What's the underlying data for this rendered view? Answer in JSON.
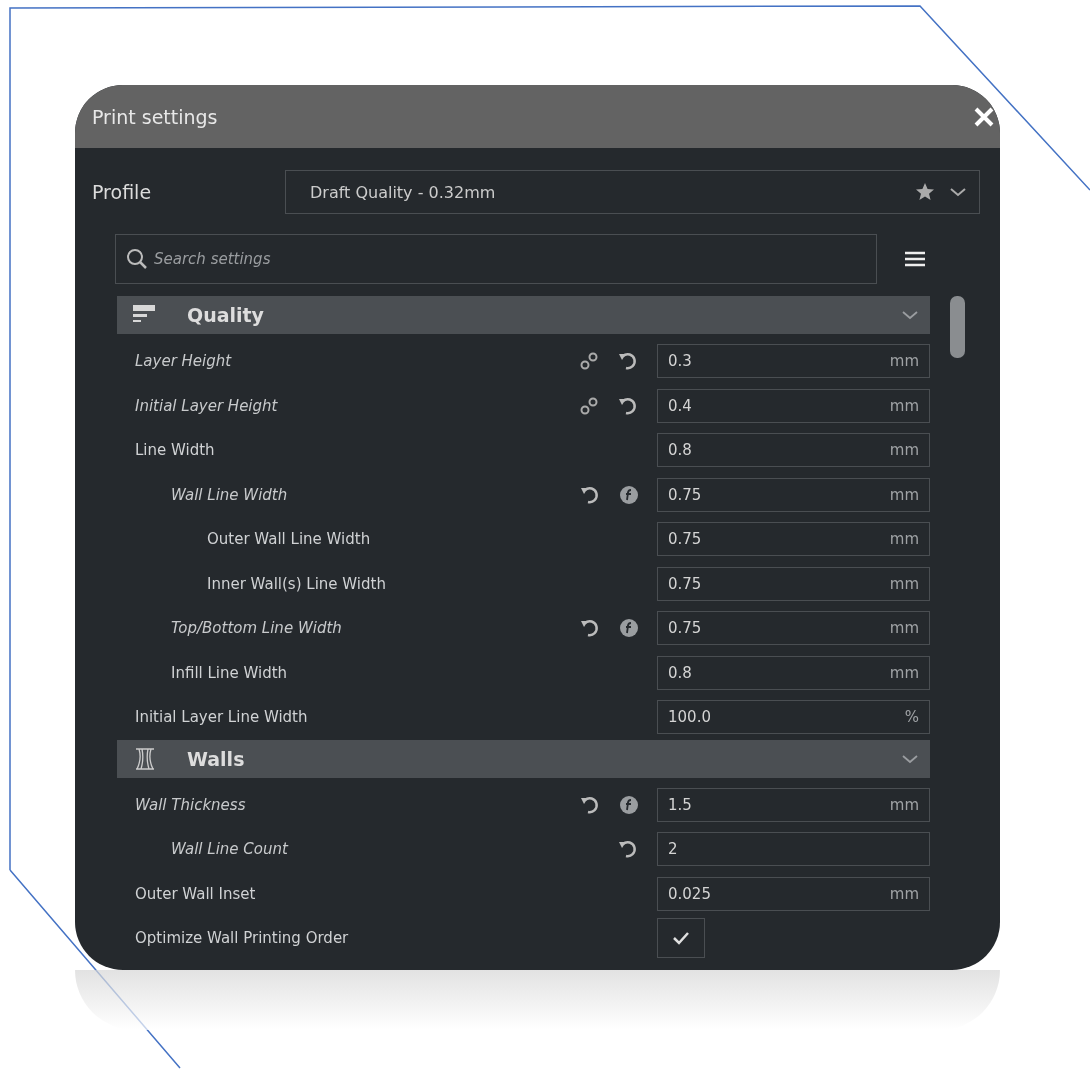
{
  "window": {
    "title": "Print settings"
  },
  "profile": {
    "label": "Profile",
    "value": "Draft Quality - 0.32mm"
  },
  "search": {
    "placeholder": "Search settings"
  },
  "sections": [
    {
      "title": "Quality",
      "kind": "quality",
      "expanded": true,
      "settings": [
        {
          "label": "Layer Height",
          "modified": true,
          "linked": true,
          "resettable": true,
          "formula": false,
          "kind": "number",
          "value": "0.3",
          "unit": "mm"
        },
        {
          "label": "Initial Layer Height",
          "modified": true,
          "linked": true,
          "resettable": true,
          "formula": false,
          "kind": "number",
          "value": "0.4",
          "unit": "mm"
        },
        {
          "label": "Line Width",
          "modified": false,
          "linked": false,
          "resettable": false,
          "formula": false,
          "kind": "number",
          "value": "0.8",
          "unit": "mm",
          "children": [
            {
              "label": "Wall Line Width",
              "modified": true,
              "linked": false,
              "resettable": true,
              "formula": true,
              "kind": "number",
              "value": "0.75",
              "unit": "mm",
              "children": [
                {
                  "label": "Outer Wall Line Width",
                  "modified": false,
                  "linked": false,
                  "resettable": false,
                  "formula": false,
                  "kind": "number",
                  "value": "0.75",
                  "unit": "mm"
                },
                {
                  "label": "Inner Wall(s) Line Width",
                  "modified": false,
                  "linked": false,
                  "resettable": false,
                  "formula": false,
                  "kind": "number",
                  "value": "0.75",
                  "unit": "mm"
                }
              ]
            },
            {
              "label": "Top/Bottom Line Width",
              "modified": true,
              "linked": false,
              "resettable": true,
              "formula": true,
              "kind": "number",
              "value": "0.75",
              "unit": "mm"
            },
            {
              "label": "Infill Line Width",
              "modified": false,
              "linked": false,
              "resettable": false,
              "formula": false,
              "kind": "number",
              "value": "0.8",
              "unit": "mm"
            }
          ]
        },
        {
          "label": "Initial Layer Line Width",
          "modified": false,
          "linked": false,
          "resettable": false,
          "formula": false,
          "kind": "number",
          "value": "100.0",
          "unit": "%"
        }
      ]
    },
    {
      "title": "Walls",
      "kind": "walls",
      "expanded": true,
      "settings": [
        {
          "label": "Wall Thickness",
          "modified": true,
          "linked": false,
          "resettable": true,
          "formula": true,
          "kind": "number",
          "value": "1.5",
          "unit": "mm",
          "children": [
            {
              "label": "Wall Line Count",
              "modified": true,
              "linked": false,
              "resettable": true,
              "formula": false,
              "kind": "number",
              "value": "2"
            }
          ]
        },
        {
          "label": "Outer Wall Inset",
          "modified": false,
          "linked": false,
          "resettable": false,
          "formula": false,
          "kind": "number",
          "value": "0.025",
          "unit": "mm"
        },
        {
          "label": "Optimize Wall Printing Order",
          "modified": false,
          "linked": false,
          "resettable": false,
          "formula": false,
          "kind": "checkbox",
          "checked": true
        }
      ]
    }
  ]
}
